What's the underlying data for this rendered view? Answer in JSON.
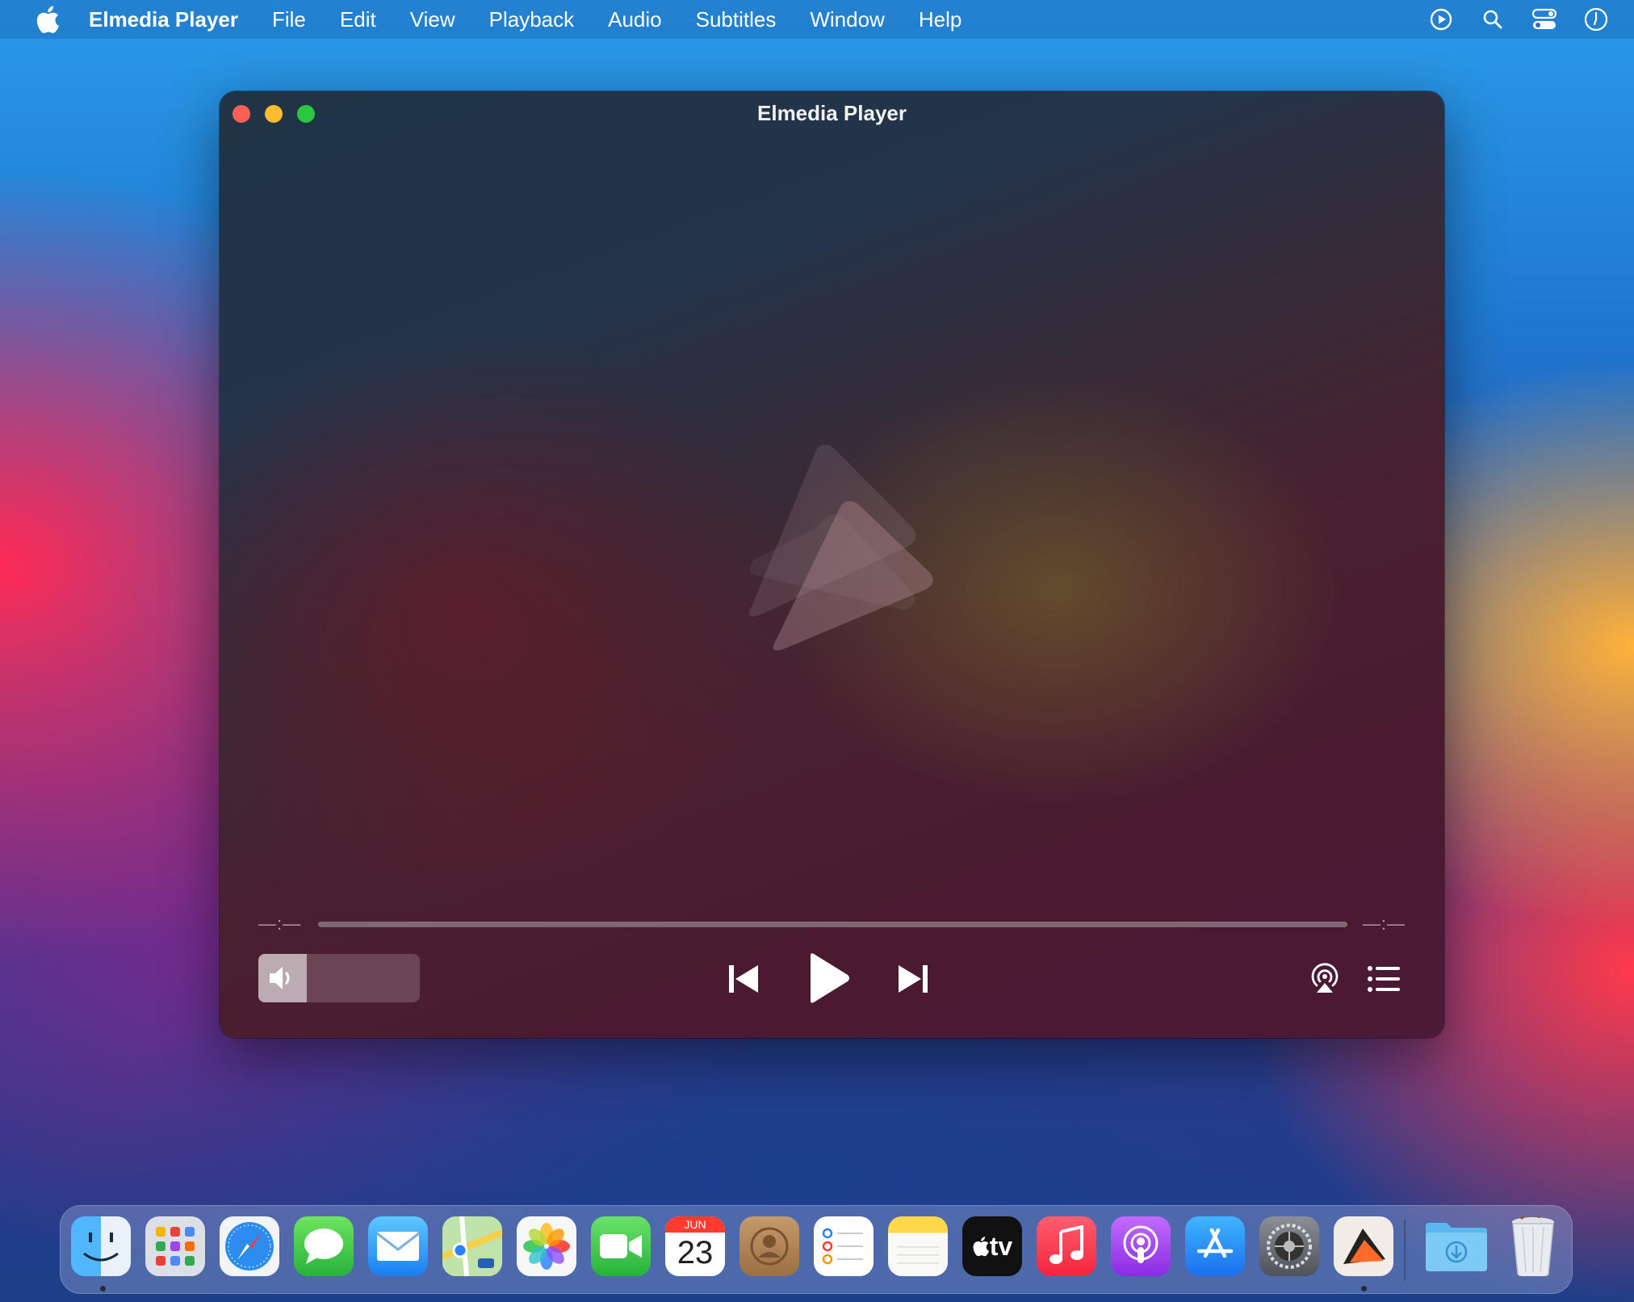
{
  "menubar": {
    "apple_icon": "apple-logo-icon",
    "app_name": "Elmedia Player",
    "items": [
      "File",
      "Edit",
      "View",
      "Playback",
      "Audio",
      "Subtitles",
      "Window",
      "Help"
    ],
    "right_icons": [
      "play-circle-icon",
      "search-icon",
      "control-center-icon",
      "clock-icon"
    ]
  },
  "window": {
    "title": "Elmedia Player",
    "time_elapsed": "—:—",
    "time_remaining": "—:—",
    "progress": 0,
    "volume_level": 0.3
  },
  "dock": {
    "apps": [
      "Finder",
      "Launchpad",
      "Safari",
      "Messages",
      "Mail",
      "Maps",
      "Photos",
      "FaceTime",
      "Calendar",
      "Contacts",
      "Reminders",
      "Notes",
      "TV",
      "Music",
      "Podcasts",
      "App Store",
      "System Preferences",
      "Elmedia Player",
      "Downloads",
      "Trash"
    ],
    "calendar_month": "JUN",
    "calendar_day": "23",
    "tv_label": "tv"
  }
}
